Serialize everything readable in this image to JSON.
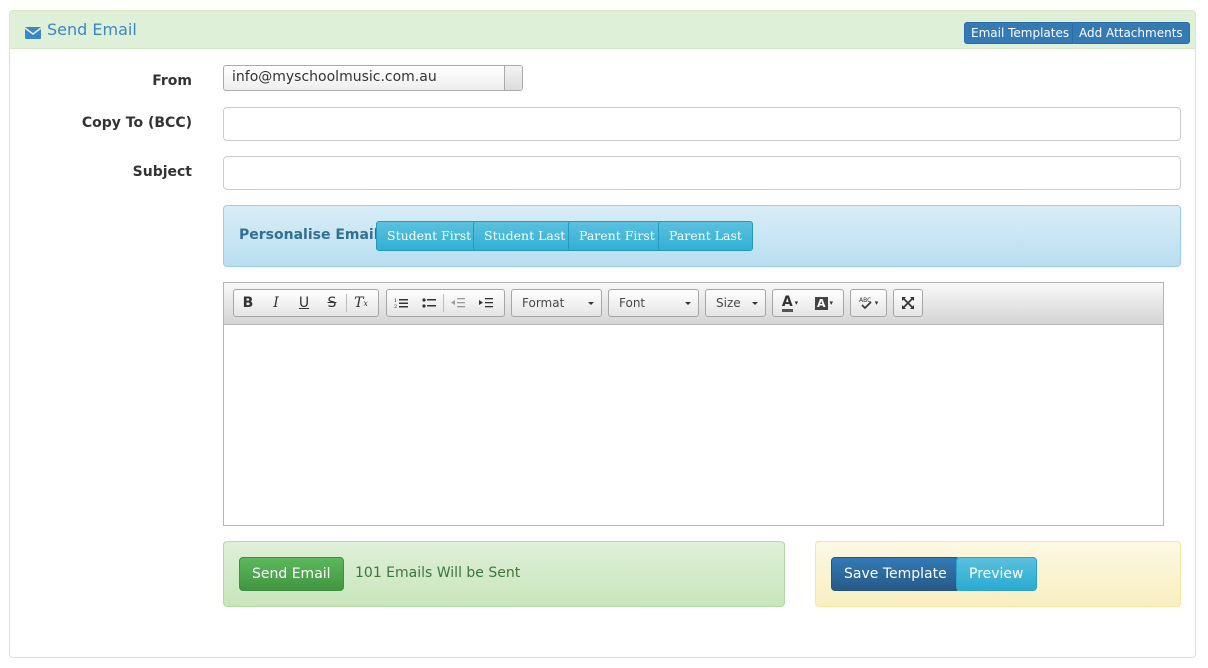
{
  "header": {
    "title": "Send Email",
    "email_templates_label": "Email Templates",
    "add_attachments_label": "Add Attachments"
  },
  "form": {
    "from_label": "From",
    "from_value": "info@myschoolmusic.com.au",
    "bcc_label": "Copy To (BCC)",
    "bcc_value": "",
    "subject_label": "Subject",
    "subject_value": ""
  },
  "personalise": {
    "label": "Personalise Email:",
    "buttons": [
      "Student First",
      "Student Last",
      "Parent First",
      "Parent Last"
    ]
  },
  "toolbar": {
    "format_label": "Format",
    "font_label": "Font",
    "size_label": "Size",
    "icons": [
      "bold-icon",
      "italic-icon",
      "underline-icon",
      "strikethrough-icon",
      "remove-format-icon",
      "numbered-list-icon",
      "bulleted-list-icon",
      "decrease-indent-icon",
      "increase-indent-icon",
      "text-color-icon",
      "background-color-icon",
      "spellcheck-icon",
      "maximize-icon"
    ]
  },
  "footer": {
    "send_label": "Send Email",
    "count_text": "101 Emails Will be Sent",
    "save_template_label": "Save Template",
    "preview_label": "Preview"
  },
  "colors": {
    "primary": "#337ab7",
    "success": "#5cb85c",
    "info": "#5bc0de",
    "heading_bg": "#dff0d8"
  }
}
